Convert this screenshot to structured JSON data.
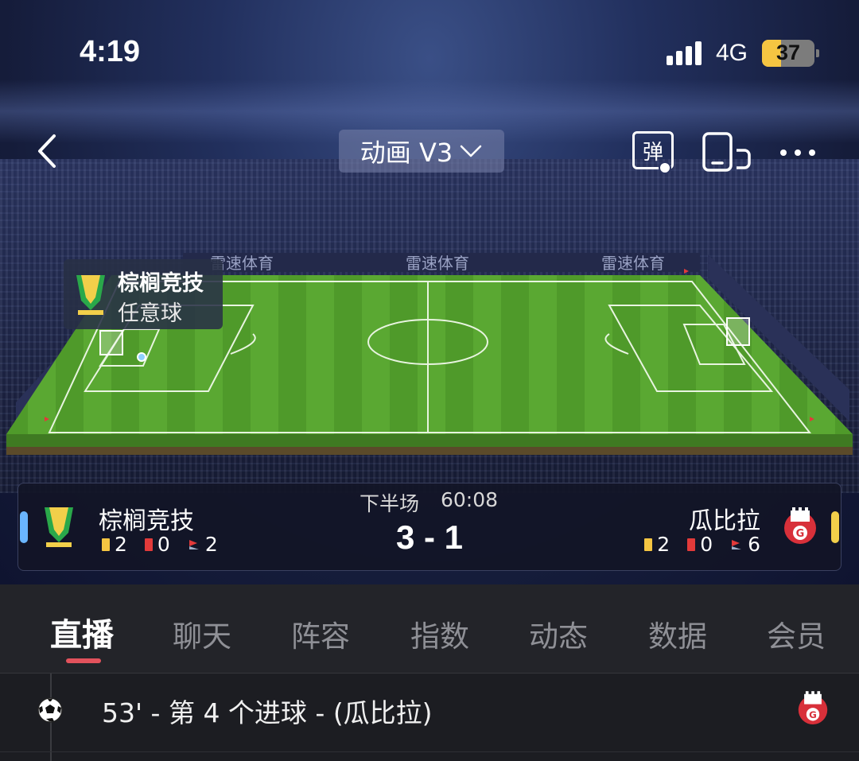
{
  "status_bar": {
    "time": "4:19",
    "network": "4G",
    "battery": "37",
    "battery_level": 0.37
  },
  "nav": {
    "mode_label": "动画 V3",
    "danmu_label": "弹"
  },
  "pitch": {
    "sponsor_text": "雷速体育"
  },
  "event_popup": {
    "team": "棕榈竞技",
    "event": "任意球"
  },
  "match": {
    "period": "下半场",
    "time": "60:08",
    "score": "3 - 1",
    "home": {
      "name": "棕榈竞技",
      "yellow": "2",
      "red": "0",
      "corners": "2",
      "accent": "#6ab5ff"
    },
    "away": {
      "name": "瓜比拉",
      "yellow": "2",
      "red": "0",
      "corners": "6",
      "accent": "#f2cf4a"
    }
  },
  "tabs": [
    {
      "label": "直播",
      "active": true
    },
    {
      "label": "聊天"
    },
    {
      "label": "阵容"
    },
    {
      "label": "指数"
    },
    {
      "label": "动态"
    },
    {
      "label": "数据"
    },
    {
      "label": "会员"
    }
  ],
  "events": [
    {
      "text": "53' - 第 4 个进球 - (瓜比拉)",
      "icon": "soccer-ball-icon"
    }
  ]
}
